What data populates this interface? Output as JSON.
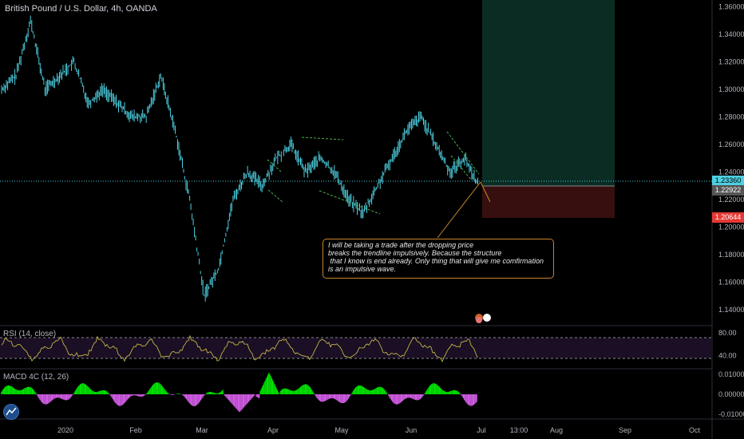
{
  "header": {
    "title": "British Pound / U.S. Dollar, 4h, OANDA"
  },
  "note": {
    "lines": [
      "I will be taking a trade after the dropping price",
      "breaks the trendline impulsively. Because the structure",
      " that I know is end already. Only thing that will give me comfirmation",
      "is an impulsive wave."
    ]
  },
  "indicators": {
    "rsi_label": "RSI (14, close)",
    "macd_label": "MACD 4C (12, 26)"
  },
  "price_tags": {
    "current": "1.23360",
    "stop": "1.22922",
    "target_low": "1.20644"
  },
  "colors": {
    "candle": "#4dd0e1",
    "up": "#26a69a",
    "rsi": "#d4c74a",
    "macd_up": "#00e300",
    "macd_down": "#d05ce3",
    "profit_zone": "#0b2e25",
    "loss_zone": "#3a1010",
    "trend_lines": "#4caf50",
    "annotation_border": "#c8852a"
  },
  "chart_data": [
    {
      "type": "line",
      "title": "British Pound / U.S. Dollar, 4h, OANDA",
      "x_ticks": [
        "2020",
        "Feb",
        "Mar",
        "Apr",
        "May",
        "Jun",
        "Jul",
        "13:00",
        "Aug",
        "Sep",
        "Oct"
      ],
      "y_ticks": [
        "1.36000",
        "1.34000",
        "1.32000",
        "1.30000",
        "1.28000",
        "1.26000",
        "1.24000",
        "1.22000",
        "1.20000",
        "1.18000",
        "1.16000",
        "1.14000"
      ],
      "ylim": [
        1.13,
        1.365
      ],
      "series": [
        {
          "x": [
            "Dec 26",
            "Jan 2",
            "Jan 8",
            "Jan 15",
            "Jan 22",
            "Jan 29",
            "Feb 5",
            "Feb 12",
            "Feb 19",
            "Feb 26",
            "Mar 4",
            "Mar 9",
            "Mar 12",
            "Mar 16",
            "Mar 19",
            "Mar 23",
            "Mar 26",
            "Mar 31",
            "Apr 3",
            "Apr 8",
            "Apr 14",
            "Apr 20",
            "Apr 27",
            "May 4",
            "May 11",
            "May 18",
            "May 25",
            "Jun 1",
            "Jun 5",
            "Jun 10",
            "Jun 15",
            "Jun 19",
            "Jun 24",
            "Jun 29"
          ],
          "values": [
            1.3,
            1.31,
            1.35,
            1.3,
            1.31,
            1.32,
            1.29,
            1.3,
            1.29,
            1.28,
            1.28,
            1.31,
            1.27,
            1.22,
            1.15,
            1.17,
            1.22,
            1.24,
            1.23,
            1.25,
            1.26,
            1.24,
            1.25,
            1.24,
            1.22,
            1.21,
            1.23,
            1.25,
            1.27,
            1.28,
            1.26,
            1.24,
            1.25,
            1.23
          ]
        }
      ]
    },
    {
      "type": "line",
      "title": "RSI (14, close)",
      "y_ticks": [
        "80.00",
        "40.00"
      ],
      "ylim": [
        20,
        90
      ]
    },
    {
      "type": "bar",
      "title": "MACD 4C (12, 26)",
      "y_ticks": [
        "0.01000",
        "0.00000",
        "-0.01000"
      ],
      "ylim": [
        -0.012,
        0.012
      ]
    }
  ]
}
